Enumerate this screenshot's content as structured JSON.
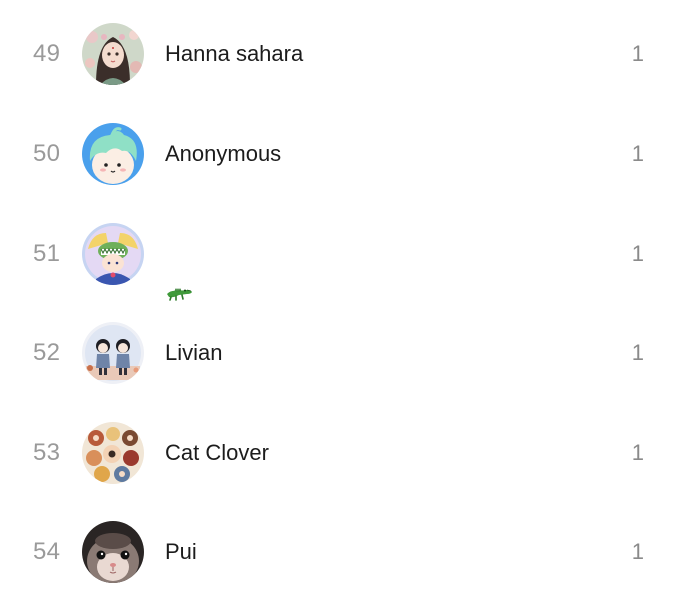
{
  "ranking": {
    "rows": [
      {
        "rank": "49",
        "name": "Hanna sahara",
        "count": "1",
        "avatar": "anime-girl-with-flowers-avatar"
      },
      {
        "rank": "50",
        "name": "Anonymous",
        "count": "1",
        "avatar": "mint-hair-character-avatar"
      },
      {
        "rank": "51",
        "name": "🐊",
        "count": "1",
        "avatar": "sailor-moon-crocodile-hat-avatar"
      },
      {
        "rank": "52",
        "name": "Livian",
        "count": "1",
        "avatar": "two-dolls-avatar"
      },
      {
        "rank": "53",
        "name": "Cat Clover",
        "count": "1",
        "avatar": "group-illustration-avatar"
      },
      {
        "rank": "54",
        "name": "Pui",
        "count": "1",
        "avatar": "hamster-face-avatar"
      }
    ]
  }
}
